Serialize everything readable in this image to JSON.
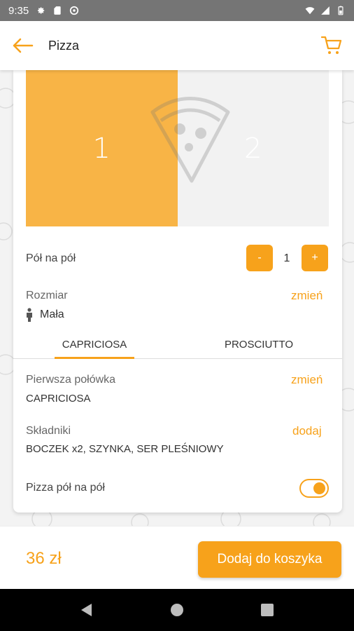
{
  "status_bar": {
    "time": "9:35"
  },
  "app_bar": {
    "title": "Pizza"
  },
  "halves": {
    "first": "1",
    "second": "2"
  },
  "half_and_half": {
    "label": "Pół na pół",
    "minus": "-",
    "quantity": "1",
    "plus": "+"
  },
  "size": {
    "label": "Rozmiar",
    "value": "Mała",
    "change": "zmień"
  },
  "tabs": [
    {
      "label": "CAPRICIOSA",
      "active": true
    },
    {
      "label": "PROSCIUTTO",
      "active": false
    }
  ],
  "first_half": {
    "label": "Pierwsza połówka",
    "value": "CAPRICIOSA",
    "change": "zmień"
  },
  "ingredients": {
    "label": "Składniki",
    "value": "BOCZEK x2, SZYNKA, SER PLEŚNIOWY",
    "add": "dodaj"
  },
  "pizza_half_toggle": {
    "label": "Pizza pół na pół",
    "on": true
  },
  "footer": {
    "price": "36 zł",
    "add_to_cart": "Dodaj do koszyka"
  },
  "colors": {
    "accent": "#f7a21b",
    "half_fill": "#f8b446"
  }
}
